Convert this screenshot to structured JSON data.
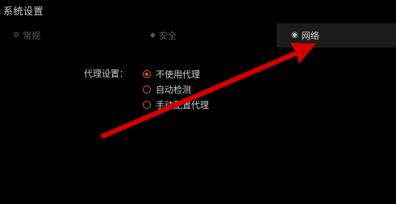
{
  "window": {
    "title": "系统设置"
  },
  "tabs": [
    {
      "label": "常规",
      "icon": "gear-icon",
      "active": false
    },
    {
      "label": "安全",
      "icon": "shield-icon",
      "active": false
    },
    {
      "label": "网络",
      "icon": "globe-icon",
      "active": true
    }
  ],
  "proxy": {
    "label": "代理设置：",
    "options": [
      {
        "label": "不使用代理",
        "checked": true
      },
      {
        "label": "自动检测",
        "checked": false
      },
      {
        "label": "手动配置代理",
        "checked": false
      }
    ]
  },
  "colors": {
    "background": "#000000",
    "active_tab_bg": "#1c1c1c",
    "radio_accent": "#e0583a",
    "annotation_arrow": "#d40000"
  }
}
